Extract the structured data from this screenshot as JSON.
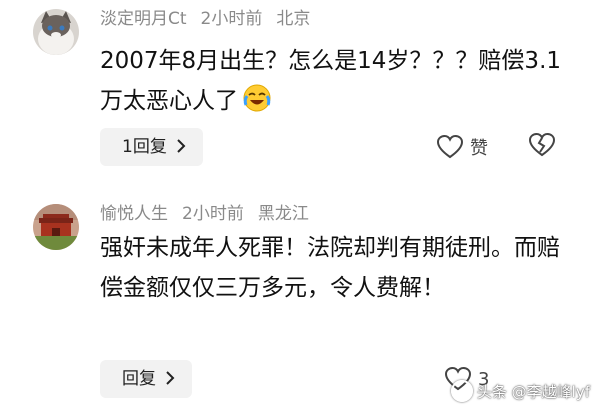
{
  "comments": [
    {
      "username": "淡定明月Ct",
      "time": "2小时前",
      "location": "北京",
      "text": "2007年8月出生？怎么是14岁？？？赔偿3.1万太恶心人了",
      "reply_label": "1回复",
      "like_label": "赞",
      "avatar_icon": "cat-avatar",
      "emoji_icon": "crying-laughing-face-icon"
    },
    {
      "username": "愉悦人生",
      "time": "2小时前",
      "location": "黑龙江",
      "text": "强奸未成年人死罪！法院却判有期徒刑。而赔偿金额仅仅三万多元，令人费解！",
      "reply_label": "回复",
      "like_count": "3",
      "avatar_icon": "gate-tower-avatar"
    }
  ],
  "watermark": "头条 @李越峰lyf",
  "colors": {
    "meta_text": "#8a8a8a",
    "button_bg": "#f2f2f2",
    "text": "#111111"
  }
}
